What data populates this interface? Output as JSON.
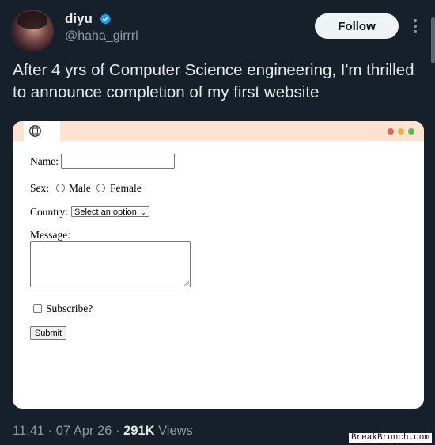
{
  "author": {
    "display_name": "diyu",
    "handle": "@haha_girrrl",
    "verified": true
  },
  "follow_label": "Follow",
  "tweet_text": "After 4 yrs of Computer Science engineering, I'm thrilled to announce completion of my first website",
  "card": {
    "form": {
      "name_label": "Name:",
      "name_value": "",
      "sex_label": "Sex:",
      "male_label": "Male",
      "female_label": "Female",
      "country_label": "Country:",
      "country_selected": "Select an option",
      "message_label": "Message:",
      "message_value": "",
      "subscribe_label": "Subscribe?",
      "submit_label": "Submit"
    },
    "window_dots": [
      "#e2675b",
      "#e5b244",
      "#5cbb4f"
    ],
    "header_color": "#fce3d1"
  },
  "meta": {
    "time": "11:41",
    "sep1": " · ",
    "date": "07 Apr 26",
    "sep2": " · ",
    "views_count": "291K",
    "views_label": " Views"
  },
  "watermark": "BreakBrunch.com"
}
